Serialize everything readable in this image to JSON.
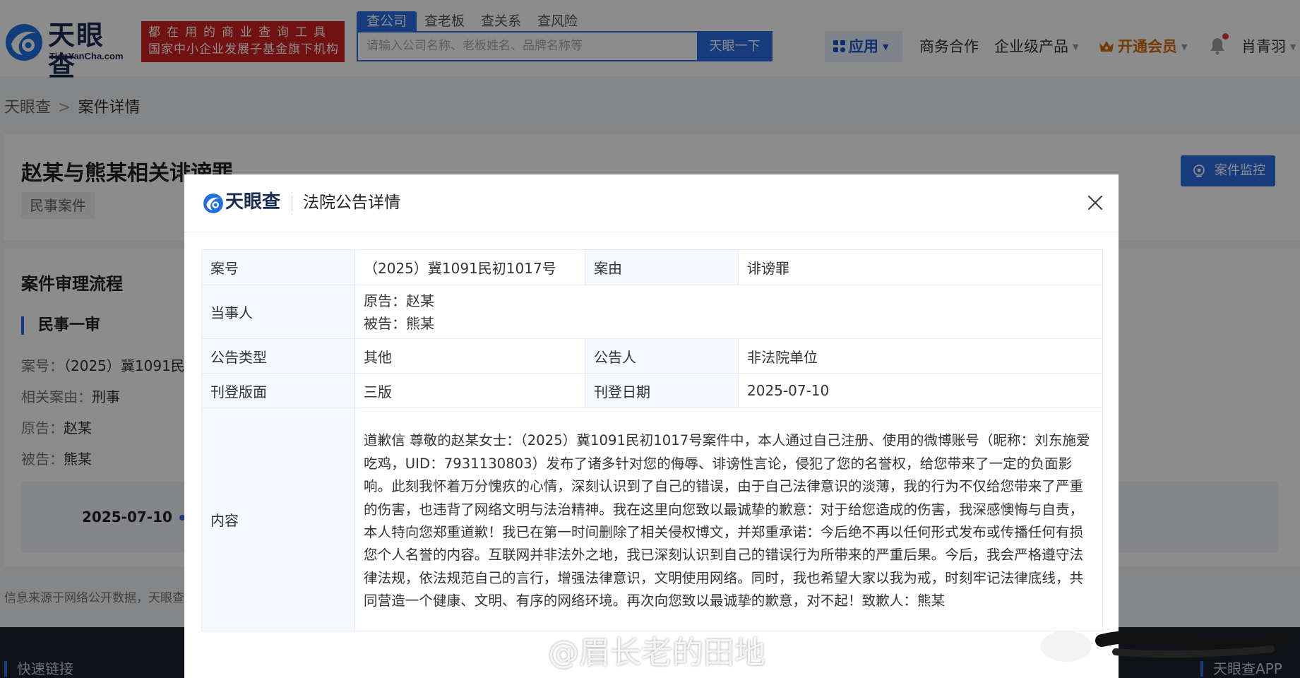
{
  "header": {
    "logo_text": "天眼查",
    "logo_domain": "TianYanCha.com",
    "slogan_line1": "都在用的商业查询工具",
    "slogan_line2": "国家中小企业发展子基金旗下机构",
    "search_tabs": [
      "查公司",
      "查老板",
      "查关系",
      "查风险"
    ],
    "search_placeholder": "请输入公司名称、老板姓名、品牌名称等",
    "search_button": "天眼一下",
    "nav_app": "应用",
    "nav_business": "商务合作",
    "nav_enterprise": "企业级产品",
    "nav_vip": "开通会员",
    "user_name": "肖青羽"
  },
  "breadcrumb": {
    "home": "天眼查",
    "current": "案件详情"
  },
  "case": {
    "title": "赵某与熊某相关诽谤罪",
    "tag": "民事案件",
    "monitor_button": "案件监控"
  },
  "flow": {
    "title": "案件审理流程",
    "stage": "民事一审",
    "lines": [
      {
        "key": "案号：",
        "value": "（2025）冀1091民"
      },
      {
        "key": "相关案由：",
        "value": "刑事"
      },
      {
        "key": "原告：",
        "value": "赵某"
      },
      {
        "key": "被告：",
        "value": "熊某"
      }
    ],
    "date": "2025-07-10"
  },
  "source_note": "信息来源于网络公开数据，天眼查",
  "footer": {
    "quick_links": "快速链接",
    "app": "天眼查APP"
  },
  "modal": {
    "logo_text": "天眼查",
    "title": "法院公告详情",
    "rows": {
      "case_no_label": "案号",
      "case_no": "（2025）冀1091民初1017号",
      "cause_label": "案由",
      "cause": "诽谤罪",
      "party_label": "当事人",
      "plaintiff": "原告：赵某",
      "defendant": "被告：熊某",
      "type_label": "公告类型",
      "type": "其他",
      "announcer_label": "公告人",
      "announcer": "非法院单位",
      "page_label": "刊登版面",
      "page": "三版",
      "date_label": "刊登日期",
      "date": "2025-07-10",
      "content_label": "内容",
      "content": "道歉信 尊敬的赵某女士：（2025）冀1091民初1017号案件中，本人通过自己注册、使用的微博账号（昵称：刘东施爱吃鸡，UID：7931130803）发布了诸多针对您的侮辱、诽谤性言论，侵犯了您的名誉权，给您带来了一定的负面影响。此刻我怀着万分愧疚的心情，深刻认识到了自己的错误，由于自己法律意识的淡薄，我的行为不仅给您带来了严重的伤害，也违背了网络文明与法治精神。我在这里向您致以最诚挚的歉意：对于给您造成的伤害，我深感懊悔与自责，本人特向您郑重道歉！我已在第一时间删除了相关侵权博文，并郑重承诺：今后绝不再以任何形式发布或传播任何有损您个人名誉的内容。互联网并非法外之地，我已深刻认识到自己的错误行为所带来的严重后果。今后，我会严格遵守法律法规，依法规范自己的言行，增强法律意识，文明使用网络。同时，我也希望大家以我为戒，时刻牢记法律底线，共同营造一个健康、文明、有序的网络环境。再次向您致以最诚挚的歉意，对不起！致歉人：熊某"
    }
  },
  "watermark": "@眉长老的田地",
  "colors": {
    "brand_blue": "#2a6ce3",
    "slogan_red": "#cf1f1f",
    "vip_orange": "#d36a0c"
  }
}
